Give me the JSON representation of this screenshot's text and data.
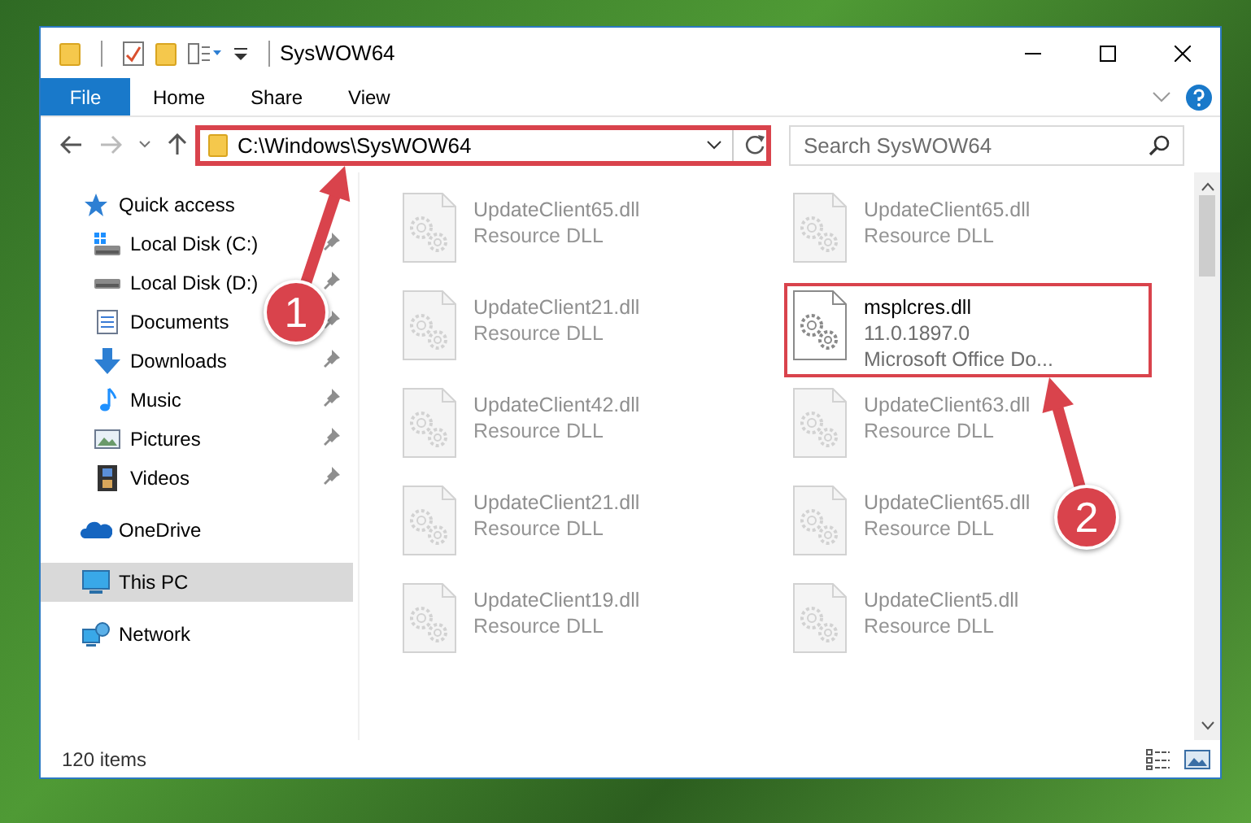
{
  "window": {
    "title": "SysWOW64"
  },
  "ribbon": {
    "tabs": [
      {
        "label": "File",
        "kind": "file"
      },
      {
        "label": "Home",
        "kind": "tab"
      },
      {
        "label": "Share",
        "kind": "tab"
      },
      {
        "label": "View",
        "kind": "tab"
      }
    ]
  },
  "address_bar": {
    "path": "C:\\Windows\\SysWOW64",
    "highlighted": true
  },
  "search": {
    "placeholder": "Search SysWOW64"
  },
  "navigation": [
    {
      "label": "Quick access",
      "kind": "star",
      "selected": false,
      "children": [
        {
          "label": "Local Disk (C:)",
          "kind": "system-drive",
          "pinned": true,
          "selected": false
        },
        {
          "label": "Local Disk (D:)",
          "kind": "drive",
          "pinned": true,
          "selected": false
        },
        {
          "label": "Documents",
          "kind": "documents",
          "pinned": true,
          "selected": false
        },
        {
          "label": "Downloads",
          "kind": "downloads",
          "pinned": true,
          "selected": false
        },
        {
          "label": "Music",
          "kind": "music",
          "pinned": true,
          "selected": false
        },
        {
          "label": "Pictures",
          "kind": "pictures",
          "pinned": true,
          "selected": false
        },
        {
          "label": "Videos",
          "kind": "videos",
          "pinned": true,
          "selected": false
        }
      ]
    },
    {
      "label": "OneDrive",
      "kind": "cloud",
      "selected": false
    },
    {
      "label": "This PC",
      "kind": "computer",
      "selected": true
    },
    {
      "label": "Network",
      "kind": "network",
      "selected": false
    }
  ],
  "files": [
    {
      "name": "UpdateClient65.dll",
      "details": [
        "Resource DLL"
      ],
      "highlighted": false
    },
    {
      "name": "UpdateClient65.dll",
      "details": [
        "Resource DLL"
      ],
      "highlighted": false
    },
    {
      "name": "UpdateClient21.dll",
      "details": [
        "Resource DLL"
      ],
      "highlighted": false
    },
    {
      "name": "msplcres.dll",
      "details": [
        "11.0.1897.0",
        "Microsoft Office Do..."
      ],
      "highlighted": true
    },
    {
      "name": "UpdateClient42.dll",
      "details": [
        "Resource DLL"
      ],
      "highlighted": false
    },
    {
      "name": "UpdateClient63.dll",
      "details": [
        "Resource DLL"
      ],
      "highlighted": false
    },
    {
      "name": "UpdateClient21.dll",
      "details": [
        "Resource DLL"
      ],
      "highlighted": false
    },
    {
      "name": "UpdateClient65.dll",
      "details": [
        "Resource DLL"
      ],
      "highlighted": false
    },
    {
      "name": "UpdateClient19.dll",
      "details": [
        "Resource DLL"
      ],
      "highlighted": false
    },
    {
      "name": "UpdateClient5.dll",
      "details": [
        "Resource DLL"
      ],
      "highlighted": false
    }
  ],
  "status_bar": {
    "item_count": "120 items"
  },
  "annotations": [
    {
      "number": "1"
    },
    {
      "number": "2"
    }
  ]
}
